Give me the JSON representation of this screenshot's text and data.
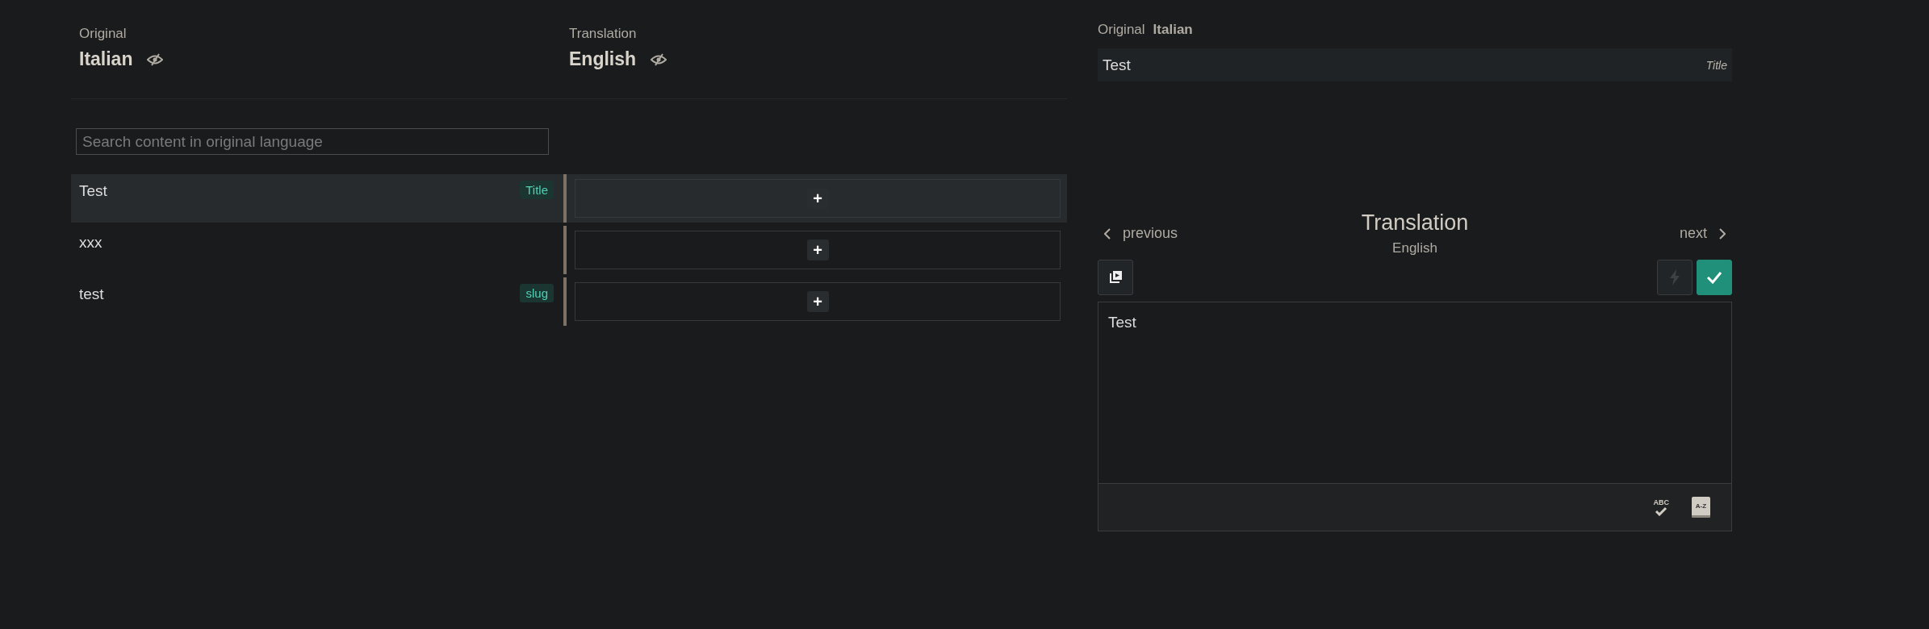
{
  "columns": [
    {
      "caption": "Original",
      "language": "Italian"
    },
    {
      "caption": "Translation",
      "language": "English"
    }
  ],
  "search": {
    "placeholder": "Search content in original language"
  },
  "rows": [
    {
      "source": "Test",
      "tag": "Title",
      "selected": true,
      "action": "+"
    },
    {
      "source": "xxx",
      "selected": false,
      "action": "+"
    },
    {
      "source": "test",
      "tag": "slug",
      "selected": false,
      "action": "+"
    }
  ],
  "editor": {
    "original_label": "Original",
    "original_language": "Italian",
    "original_text": "Test",
    "original_type": "Title",
    "previous": "previous",
    "next": "next",
    "title": "Translation",
    "language": "English",
    "auto_translate_disabled": true,
    "approved": true,
    "value": "Test",
    "spellcheck": "ABC",
    "glossary": "A-Z"
  }
}
